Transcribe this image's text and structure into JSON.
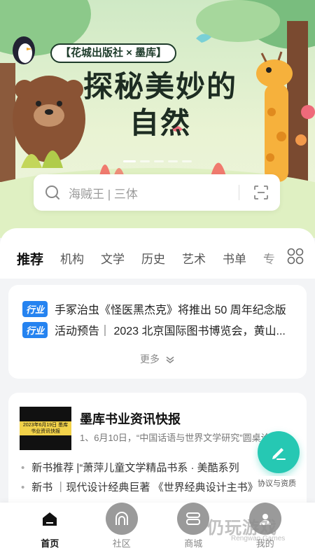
{
  "banner": {
    "publisher_tag": "【花城出版社 × 墨库】",
    "title_line1": "探秘美妙的",
    "title_line2": "自然"
  },
  "search": {
    "placeholder": "海贼王 | 三体",
    "icon": "search-icon",
    "scan_icon": "scan-icon"
  },
  "tabs": [
    {
      "label": "推荐",
      "active": true
    },
    {
      "label": "机构"
    },
    {
      "label": "文学"
    },
    {
      "label": "历史"
    },
    {
      "label": "艺术"
    },
    {
      "label": "书单"
    },
    {
      "label": "专"
    }
  ],
  "news": {
    "items": [
      {
        "badge": "行业",
        "text": "手冢治虫《怪医黑杰克》将推出 50 周年纪念版"
      },
      {
        "badge": "行业",
        "text": "活动预告｜ 2023 北京国际图书博览会，黄山..."
      }
    ],
    "more_label": "更多"
  },
  "article": {
    "thumb_label": "2023年6月19日 墨库书业资讯快报",
    "title": "墨库书业资讯快报",
    "subtitle": "1、6月10日，“中国话语与世界文学研究”圆桌论",
    "bullets": [
      "新书推荐 |“萧萍儿童文学精品书系 · 美酷系列",
      "新书 ｜现代设计经典巨著 《世界经典设计主书》"
    ]
  },
  "fab": {
    "label": "协议与资质"
  },
  "nav": [
    {
      "label": "首页",
      "active": true
    },
    {
      "label": "社区"
    },
    {
      "label": "商城"
    },
    {
      "label": "我的"
    }
  ],
  "watermark": {
    "text": "仍玩游戏",
    "sub": "Rengwan Games"
  },
  "colors": {
    "accent": "#26c8b3",
    "badge": "#2583f0",
    "tab_underline": "#4fd6c7"
  }
}
